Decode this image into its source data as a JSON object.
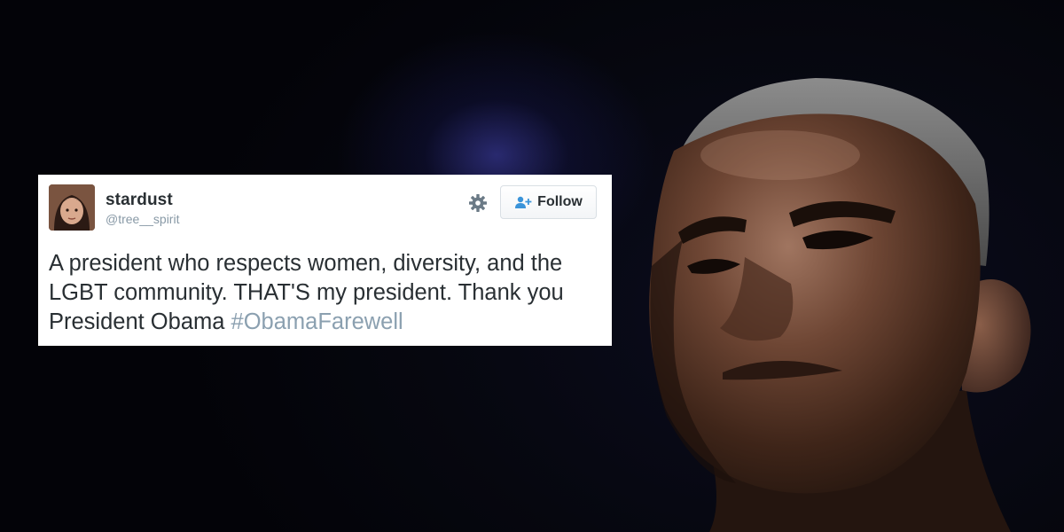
{
  "tweet": {
    "display_name": "stardust",
    "handle": "@tree__spirit",
    "follow_label": "Follow",
    "text_main": "A president who respects women, diversity, and the LGBT community. THAT'S my president. Thank you President Obama",
    "hashtag": "#ObamaFarewell"
  },
  "icons": {
    "settings": "gear-icon",
    "follow": "add-user-icon"
  },
  "colors": {
    "card_bg": "#ffffff",
    "text": "#292f33",
    "handle": "#8899a6",
    "hashtag": "#8ba0b0",
    "background": "#05060d"
  }
}
